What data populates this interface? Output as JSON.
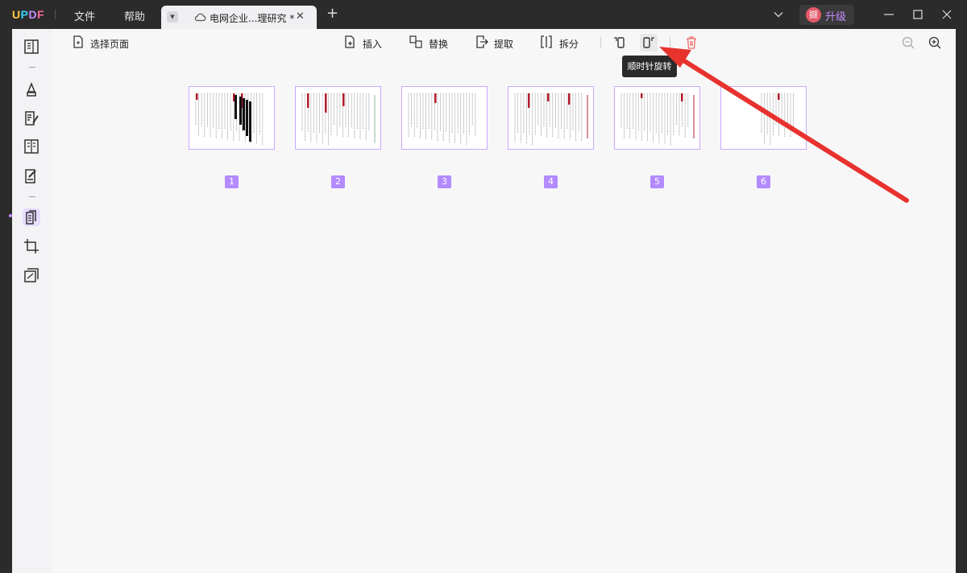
{
  "app": {
    "logo": "UPDF"
  },
  "menu": {
    "file": "文件",
    "help": "帮助"
  },
  "tab": {
    "title": "电网企业...理研究 *",
    "close": "✕",
    "new_tab": "+"
  },
  "upgrade": {
    "avatar": "撷",
    "label": "升级"
  },
  "toolbar": {
    "select_pages": "选择页面",
    "insert": "插入",
    "replace": "替换",
    "extract": "提取",
    "split": "拆分",
    "tooltip": "顺时针旋转"
  },
  "pages": [
    {
      "number": "1"
    },
    {
      "number": "2"
    },
    {
      "number": "3"
    },
    {
      "number": "4"
    },
    {
      "number": "5"
    },
    {
      "number": "6"
    }
  ],
  "colors": {
    "accent": "#b48aff",
    "arrow": "#e8322e",
    "delete": "#f06a6a"
  }
}
